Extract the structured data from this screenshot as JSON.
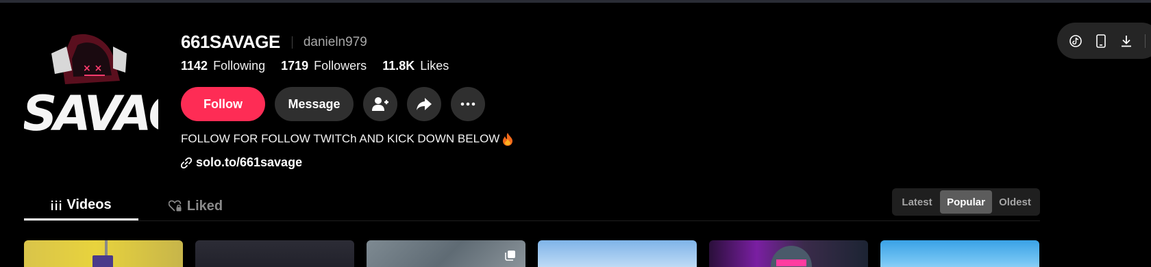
{
  "profile": {
    "username": "661SAVAGE",
    "nickname": "danieln979",
    "avatar_text": "SAVAGE",
    "stats": {
      "following_count": "1142",
      "following_label": "Following",
      "followers_count": "1719",
      "followers_label": "Followers",
      "likes_count": "11.8K",
      "likes_label": "Likes"
    },
    "bio": "FOLLOW FOR FOLLOW TWITCh AND KICK DOWN BELOW",
    "bio_emoji": "fire-icon",
    "link": "solo.to/661savage"
  },
  "actions": {
    "follow_label": "Follow",
    "message_label": "Message",
    "add_friend_icon": "add-user-icon",
    "share_icon": "share-icon",
    "more_icon": "more-icon"
  },
  "tabs": {
    "videos_label": "Videos",
    "liked_label": "Liked",
    "active": "Videos"
  },
  "sort": {
    "options": [
      "Latest",
      "Popular",
      "Oldest"
    ],
    "selected": "Popular"
  },
  "side_panel": {
    "icons": [
      "tiktok-icon",
      "mobile-icon",
      "download-icon"
    ]
  },
  "colors": {
    "accent": "#fe2c55",
    "background": "#000000",
    "button_secondary": "#2f2f2f"
  }
}
